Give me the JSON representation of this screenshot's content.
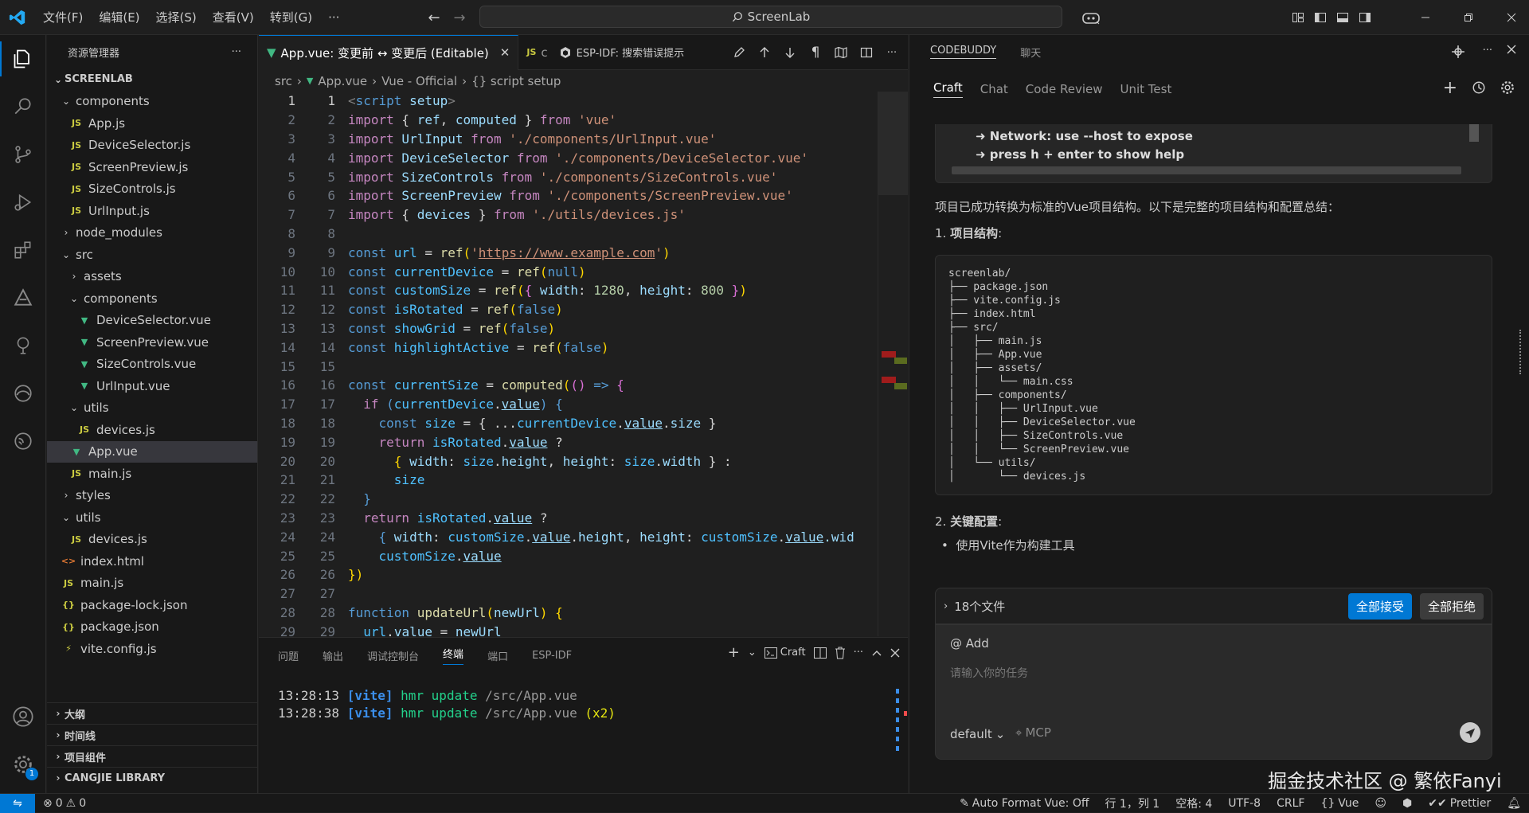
{
  "menu": [
    "文件(F)",
    "编辑(E)",
    "选择(S)",
    "查看(V)",
    "转到(G)",
    "···"
  ],
  "search": {
    "text": "ScreenLab"
  },
  "sidebar": {
    "title": "资源管理器",
    "root": "SCREENLAB",
    "tree": [
      {
        "depth": 1,
        "type": "folder",
        "open": true,
        "name": "components"
      },
      {
        "depth": 2,
        "type": "js",
        "name": "App.js"
      },
      {
        "depth": 2,
        "type": "js",
        "name": "DeviceSelector.js"
      },
      {
        "depth": 2,
        "type": "js",
        "name": "ScreenPreview.js"
      },
      {
        "depth": 2,
        "type": "js",
        "name": "SizeControls.js"
      },
      {
        "depth": 2,
        "type": "js",
        "name": "UrlInput.js"
      },
      {
        "depth": 1,
        "type": "folder",
        "open": false,
        "name": "node_modules"
      },
      {
        "depth": 1,
        "type": "folder",
        "open": true,
        "name": "src"
      },
      {
        "depth": 2,
        "type": "folder",
        "open": false,
        "name": "assets"
      },
      {
        "depth": 2,
        "type": "folder",
        "open": true,
        "name": "components"
      },
      {
        "depth": 3,
        "type": "vue",
        "name": "DeviceSelector.vue"
      },
      {
        "depth": 3,
        "type": "vue",
        "name": "ScreenPreview.vue"
      },
      {
        "depth": 3,
        "type": "vue",
        "name": "SizeControls.vue"
      },
      {
        "depth": 3,
        "type": "vue",
        "name": "UrlInput.vue"
      },
      {
        "depth": 2,
        "type": "folder",
        "open": true,
        "name": "utils"
      },
      {
        "depth": 3,
        "type": "js",
        "name": "devices.js"
      },
      {
        "depth": 2,
        "type": "vue",
        "name": "App.vue",
        "selected": true
      },
      {
        "depth": 2,
        "type": "js",
        "name": "main.js"
      },
      {
        "depth": 1,
        "type": "folder",
        "open": false,
        "name": "styles"
      },
      {
        "depth": 1,
        "type": "folder",
        "open": true,
        "name": "utils"
      },
      {
        "depth": 2,
        "type": "js",
        "name": "devices.js"
      },
      {
        "depth": 1,
        "type": "html",
        "name": "index.html"
      },
      {
        "depth": 1,
        "type": "js",
        "name": "main.js"
      },
      {
        "depth": 1,
        "type": "json",
        "name": "package-lock.json"
      },
      {
        "depth": 1,
        "type": "json",
        "name": "package.json"
      },
      {
        "depth": 1,
        "type": "cfg",
        "name": "vite.config.js"
      }
    ],
    "sections": [
      "大纲",
      "时间线",
      "项目组件",
      "CANGJIE LIBRARY"
    ]
  },
  "editor": {
    "tab_active": "App.vue: 变更前 ↔ 变更后 (Editable)",
    "tab_js": "c",
    "tab_esp": "ESP-IDF: 搜索错误提示",
    "breadcrumb": [
      "src",
      "App.vue",
      "Vue - Official",
      "{} script setup"
    ],
    "lines": [
      [
        {
          "t": "<",
          "c": "t"
        },
        {
          "t": "script",
          "c": "tg"
        },
        {
          "t": " ",
          "c": "p"
        },
        {
          "t": "setup",
          "c": "v"
        },
        {
          "t": ">",
          "c": "t"
        }
      ],
      [
        {
          "t": "import",
          "c": "kw"
        },
        {
          "t": " { ",
          "c": "p"
        },
        {
          "t": "ref",
          "c": "v"
        },
        {
          "t": ", ",
          "c": "p"
        },
        {
          "t": "computed",
          "c": "v"
        },
        {
          "t": " } ",
          "c": "p"
        },
        {
          "t": "from",
          "c": "kw"
        },
        {
          "t": " 'vue'",
          "c": "s"
        }
      ],
      [
        {
          "t": "import",
          "c": "kw"
        },
        {
          "t": " UrlInput ",
          "c": "v"
        },
        {
          "t": "from",
          "c": "kw"
        },
        {
          "t": " './components/UrlInput.vue'",
          "c": "s"
        }
      ],
      [
        {
          "t": "import",
          "c": "kw"
        },
        {
          "t": " DeviceSelector ",
          "c": "v"
        },
        {
          "t": "from",
          "c": "kw"
        },
        {
          "t": " './components/DeviceSelector.vue'",
          "c": "s"
        }
      ],
      [
        {
          "t": "import",
          "c": "kw"
        },
        {
          "t": " SizeControls ",
          "c": "v"
        },
        {
          "t": "from",
          "c": "kw"
        },
        {
          "t": " './components/SizeControls.vue'",
          "c": "s"
        }
      ],
      [
        {
          "t": "import",
          "c": "kw"
        },
        {
          "t": " ScreenPreview ",
          "c": "v"
        },
        {
          "t": "from",
          "c": "kw"
        },
        {
          "t": " './components/ScreenPreview.vue'",
          "c": "s"
        }
      ],
      [
        {
          "t": "import",
          "c": "kw"
        },
        {
          "t": " { ",
          "c": "p"
        },
        {
          "t": "devices",
          "c": "v"
        },
        {
          "t": " } ",
          "c": "p"
        },
        {
          "t": "from",
          "c": "kw"
        },
        {
          "t": " './utils/devices.js'",
          "c": "s"
        }
      ],
      [],
      [
        {
          "t": "const",
          "c": "k"
        },
        {
          "t": " url ",
          "c": "c"
        },
        {
          "t": "= ",
          "c": "p"
        },
        {
          "t": "ref",
          "c": "f"
        },
        {
          "t": "(",
          "c": "y"
        },
        {
          "t": "'",
          "c": "s"
        },
        {
          "t": "https://www.example.com",
          "c": "s u"
        },
        {
          "t": "'",
          "c": "s"
        },
        {
          "t": ")",
          "c": "y"
        }
      ],
      [
        {
          "t": "const",
          "c": "k"
        },
        {
          "t": " currentDevice ",
          "c": "c"
        },
        {
          "t": "= ",
          "c": "p"
        },
        {
          "t": "ref",
          "c": "f"
        },
        {
          "t": "(",
          "c": "y"
        },
        {
          "t": "null",
          "c": "k"
        },
        {
          "t": ")",
          "c": "y"
        }
      ],
      [
        {
          "t": "const",
          "c": "k"
        },
        {
          "t": " customSize ",
          "c": "c"
        },
        {
          "t": "= ",
          "c": "p"
        },
        {
          "t": "ref",
          "c": "f"
        },
        {
          "t": "(",
          "c": "y"
        },
        {
          "t": "{ ",
          "c": "pk"
        },
        {
          "t": "width",
          "c": "v"
        },
        {
          "t": ": ",
          "c": "p"
        },
        {
          "t": "1280",
          "c": "n"
        },
        {
          "t": ", ",
          "c": "p"
        },
        {
          "t": "height",
          "c": "v"
        },
        {
          "t": ": ",
          "c": "p"
        },
        {
          "t": "800",
          "c": "n"
        },
        {
          "t": " }",
          "c": "pk"
        },
        {
          "t": ")",
          "c": "y"
        }
      ],
      [
        {
          "t": "const",
          "c": "k"
        },
        {
          "t": " isRotated ",
          "c": "c"
        },
        {
          "t": "= ",
          "c": "p"
        },
        {
          "t": "ref",
          "c": "f"
        },
        {
          "t": "(",
          "c": "y"
        },
        {
          "t": "false",
          "c": "k"
        },
        {
          "t": ")",
          "c": "y"
        }
      ],
      [
        {
          "t": "const",
          "c": "k"
        },
        {
          "t": " showGrid ",
          "c": "c"
        },
        {
          "t": "= ",
          "c": "p"
        },
        {
          "t": "ref",
          "c": "f"
        },
        {
          "t": "(",
          "c": "y"
        },
        {
          "t": "false",
          "c": "k"
        },
        {
          "t": ")",
          "c": "y"
        }
      ],
      [
        {
          "t": "const",
          "c": "k"
        },
        {
          "t": " highlightActive ",
          "c": "c"
        },
        {
          "t": "= ",
          "c": "p"
        },
        {
          "t": "ref",
          "c": "f"
        },
        {
          "t": "(",
          "c": "y"
        },
        {
          "t": "false",
          "c": "k"
        },
        {
          "t": ")",
          "c": "y"
        }
      ],
      [],
      [
        {
          "t": "const",
          "c": "k"
        },
        {
          "t": " currentSize ",
          "c": "c"
        },
        {
          "t": "= ",
          "c": "p"
        },
        {
          "t": "computed",
          "c": "f"
        },
        {
          "t": "(",
          "c": "y"
        },
        {
          "t": "() ",
          "c": "pk"
        },
        {
          "t": "=>",
          "c": "k"
        },
        {
          "t": " {",
          "c": "pk"
        }
      ],
      [
        {
          "t": "  if",
          "c": "kw"
        },
        {
          "t": " (",
          "c": "k"
        },
        {
          "t": "currentDevice",
          "c": "c"
        },
        {
          "t": ".",
          "c": "p"
        },
        {
          "t": "value",
          "c": "v u"
        },
        {
          "t": ") {",
          "c": "k"
        }
      ],
      [
        {
          "t": "    const",
          "c": "k"
        },
        {
          "t": " size ",
          "c": "c"
        },
        {
          "t": "= { ...",
          "c": "p"
        },
        {
          "t": "currentDevice",
          "c": "c"
        },
        {
          "t": ".",
          "c": "p"
        },
        {
          "t": "value",
          "c": "v u"
        },
        {
          "t": ".",
          "c": "p"
        },
        {
          "t": "size",
          "c": "v"
        },
        {
          "t": " }",
          "c": "p"
        }
      ],
      [
        {
          "t": "    return",
          "c": "kw"
        },
        {
          "t": " isRotated",
          "c": "c"
        },
        {
          "t": ".",
          "c": "p"
        },
        {
          "t": "value",
          "c": "v u"
        },
        {
          "t": " ?",
          "c": "p"
        }
      ],
      [
        {
          "t": "      { ",
          "c": "y"
        },
        {
          "t": "width",
          "c": "v"
        },
        {
          "t": ": ",
          "c": "p"
        },
        {
          "t": "size",
          "c": "c"
        },
        {
          "t": ".",
          "c": "p"
        },
        {
          "t": "height",
          "c": "v"
        },
        {
          "t": ", ",
          "c": "p"
        },
        {
          "t": "height",
          "c": "v"
        },
        {
          "t": ": ",
          "c": "p"
        },
        {
          "t": "size",
          "c": "c"
        },
        {
          "t": ".",
          "c": "p"
        },
        {
          "t": "width",
          "c": "v"
        },
        {
          "t": " } :",
          "c": "p"
        }
      ],
      [
        {
          "t": "      size",
          "c": "c"
        }
      ],
      [
        {
          "t": "  }",
          "c": "k"
        }
      ],
      [
        {
          "t": "  return",
          "c": "kw"
        },
        {
          "t": " isRotated",
          "c": "c"
        },
        {
          "t": ".",
          "c": "p"
        },
        {
          "t": "value",
          "c": "v u"
        },
        {
          "t": " ?",
          "c": "p"
        }
      ],
      [
        {
          "t": "    { ",
          "c": "k"
        },
        {
          "t": "width",
          "c": "v"
        },
        {
          "t": ": ",
          "c": "p"
        },
        {
          "t": "customSize",
          "c": "c"
        },
        {
          "t": ".",
          "c": "p"
        },
        {
          "t": "value",
          "c": "v u"
        },
        {
          "t": ".",
          "c": "p"
        },
        {
          "t": "height",
          "c": "v"
        },
        {
          "t": ", ",
          "c": "p"
        },
        {
          "t": "height",
          "c": "v"
        },
        {
          "t": ": ",
          "c": "p"
        },
        {
          "t": "customSize",
          "c": "c"
        },
        {
          "t": ".",
          "c": "p"
        },
        {
          "t": "value",
          "c": "v u"
        },
        {
          "t": ".wid",
          "c": "v"
        }
      ],
      [
        {
          "t": "    customSize",
          "c": "c"
        },
        {
          "t": ".",
          "c": "p"
        },
        {
          "t": "value",
          "c": "v u"
        }
      ],
      [
        {
          "t": "})",
          "c": "y"
        }
      ],
      [],
      [
        {
          "t": "function",
          "c": "k"
        },
        {
          "t": " updateUrl",
          "c": "f"
        },
        {
          "t": "(",
          "c": "y"
        },
        {
          "t": "newUrl",
          "c": "v"
        },
        {
          "t": ") {",
          "c": "y"
        }
      ],
      [
        {
          "t": "  url",
          "c": "c"
        },
        {
          "t": ".",
          "c": "p"
        },
        {
          "t": "value",
          "c": "v u"
        },
        {
          "t": " = ",
          "c": "p"
        },
        {
          "t": "newUrl",
          "c": "v"
        }
      ]
    ]
  },
  "panel": {
    "tabs": [
      "问题",
      "输出",
      "调试控制台",
      "终端",
      "端口",
      "ESP-IDF"
    ],
    "active_tab": "终端",
    "craft_label": "Craft",
    "terminal": [
      {
        "time": "13:28:13",
        "tag": "[vite]",
        "msg": "hmr update",
        "path": "/src/App.vue",
        "extra": ""
      },
      {
        "time": "13:28:38",
        "tag": "[vite]",
        "msg": "hmr update",
        "path": "/src/App.vue",
        "extra": "(x2)"
      }
    ]
  },
  "right": {
    "head_tabs": [
      "CODEBUDDY",
      "聊天"
    ],
    "tabs": [
      "Craft",
      "Chat",
      "Code Review",
      "Unit Test"
    ],
    "active_tab": "Craft",
    "term_lines": [
      "➜  Network: use --host to expose",
      "➜  press h + enter to show help"
    ],
    "summary": "项目已成功转换为标准的Vue项目结构。以下是完整的项目结构和配置总结：",
    "h1_num": "1. ",
    "h1": "项目结构",
    "tree": "screenlab/\n├── package.json\n├── vite.config.js\n├── index.html\n├── src/\n│   ├── main.js\n│   ├── App.vue\n│   ├── assets/\n│   │   └── main.css\n│   ├── components/\n│   │   ├── UrlInput.vue\n│   │   ├── DeviceSelector.vue\n│   │   ├── SizeControls.vue\n│   │   └── ScreenPreview.vue\n│   └── utils/\n│       └── devices.js",
    "h2_num": "2. ",
    "h2": "关键配置",
    "bullet": "使用Vite作为构建工具",
    "files_label": "18个文件",
    "accept_all": "全部接受",
    "reject_all": "全部拒绝",
    "add_label": "@ Add",
    "input_placeholder": "请输入你的任务",
    "mode": "default",
    "mcp": "MCP",
    "watermark": "掘金技术社区 @ 繁依Fanyi"
  },
  "status": {
    "errors": "0",
    "warnings": "0",
    "auto_format": "Auto Format Vue: Off",
    "position": "行 1，列 1",
    "spaces": "空格: 4",
    "encoding": "UTF-8",
    "eol": "CRLF",
    "lang": "Vue",
    "prettier": "Prettier"
  },
  "colors": {
    "accent": "#0078d4",
    "vue": "#41b883",
    "js": "#cbcb41",
    "bg": "#1f1f1f"
  }
}
